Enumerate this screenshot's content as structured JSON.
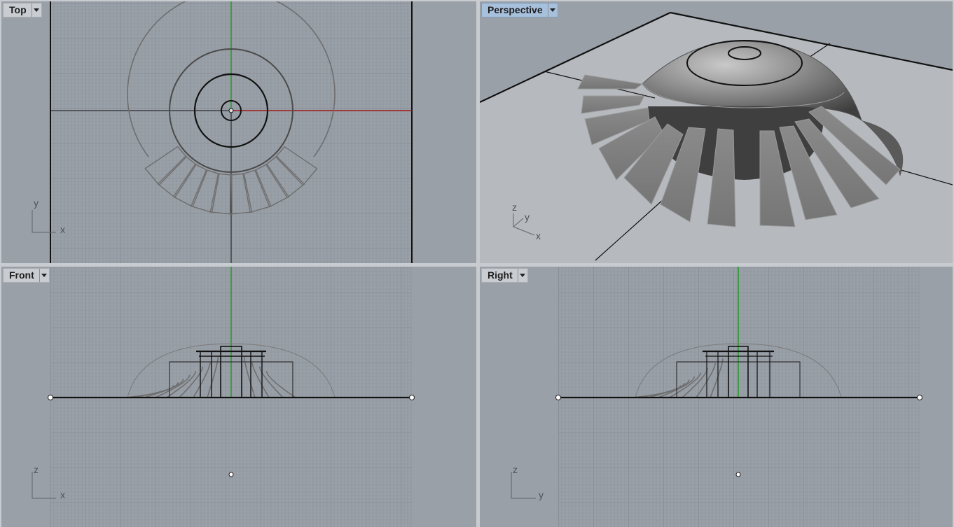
{
  "viewports": {
    "top": {
      "title": "Top",
      "axis_v": "y",
      "axis_h": "x"
    },
    "perspective": {
      "title": "Perspective",
      "axis_z": "z",
      "axis_y": "y",
      "axis_x": "x"
    },
    "front": {
      "title": "Front",
      "axis_v": "z",
      "axis_h": "x"
    },
    "right": {
      "title": "Right",
      "axis_v": "z",
      "axis_h": "y"
    }
  },
  "colors": {
    "viewport_bg": "#9aa0a8",
    "shaded_bg": "#b4b8bd",
    "grid_minor": "#8d939b",
    "grid_major": "#7a8089",
    "axis_green": "#1a9a1a",
    "axis_red": "#a01818",
    "active_tab": "#a7c0dc"
  }
}
